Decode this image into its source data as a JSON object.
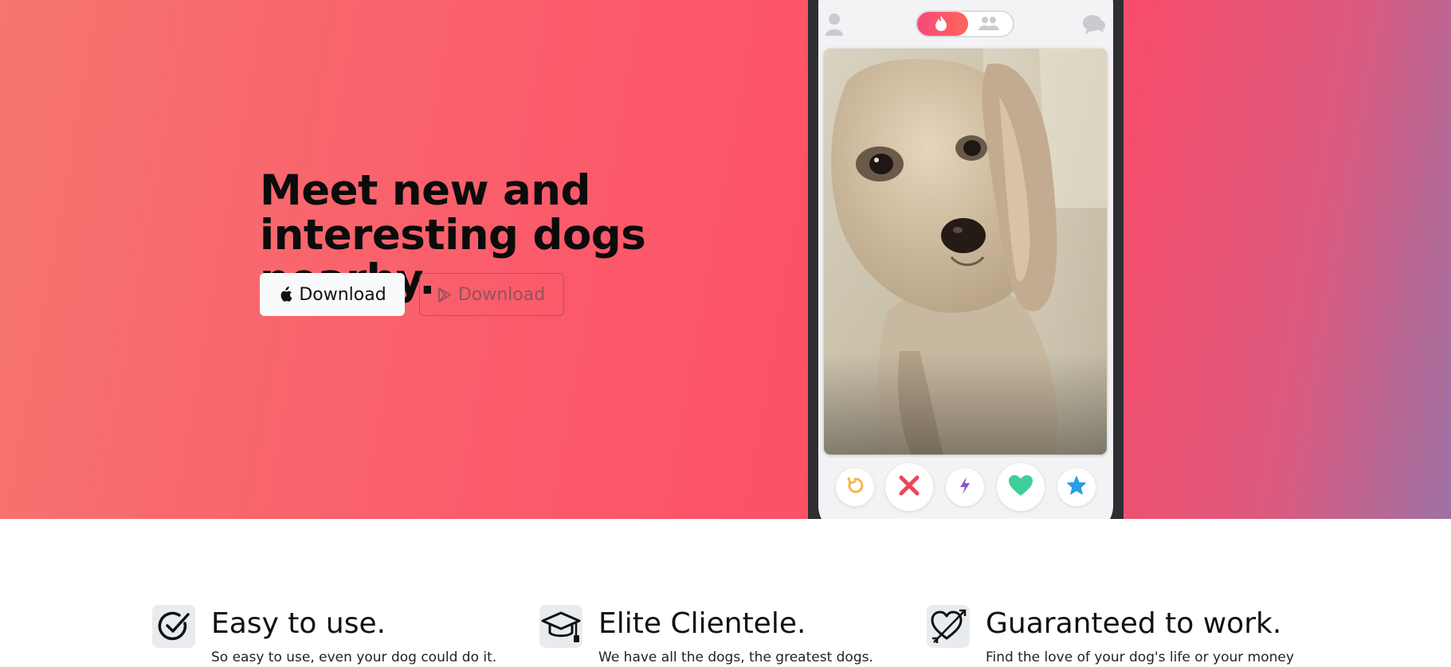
{
  "hero": {
    "headline": "Meet new and interesting dogs nearby.",
    "buttons": {
      "apple_label": "Download",
      "play_label": "Download"
    }
  },
  "phone": {
    "topbar": {
      "left_icon": "profile-icon",
      "toggle_active_icon": "flame-icon",
      "toggle_inactive_icon": "group-icon",
      "right_icon": "chat-icon"
    },
    "card_image": "dog-photo",
    "actions": [
      {
        "icon": "rewind-icon",
        "color": "#f5b748"
      },
      {
        "icon": "nope-icon",
        "color": "#ec4458"
      },
      {
        "icon": "boost-icon",
        "color": "#8b54c7"
      },
      {
        "icon": "like-icon",
        "color": "#3fcf9a"
      },
      {
        "icon": "super-like-icon",
        "color": "#2b9ee8"
      }
    ]
  },
  "features": [
    {
      "icon": "check-circle-icon",
      "title": "Easy to use.",
      "description": "So easy to use, even your dog could do it."
    },
    {
      "icon": "graduation-cap-icon",
      "title": "Elite Clientele.",
      "description": "We have all the dogs, the greatest dogs."
    },
    {
      "icon": "heart-arrow-icon",
      "title": "Guaranteed to work.",
      "description": "Find the love of your dog's life or your money"
    }
  ],
  "colors": {
    "brand_gradient_start": "#f6756f",
    "brand_gradient_mid": "#fe4a65",
    "brand_gradient_end": "#9e72a4"
  }
}
